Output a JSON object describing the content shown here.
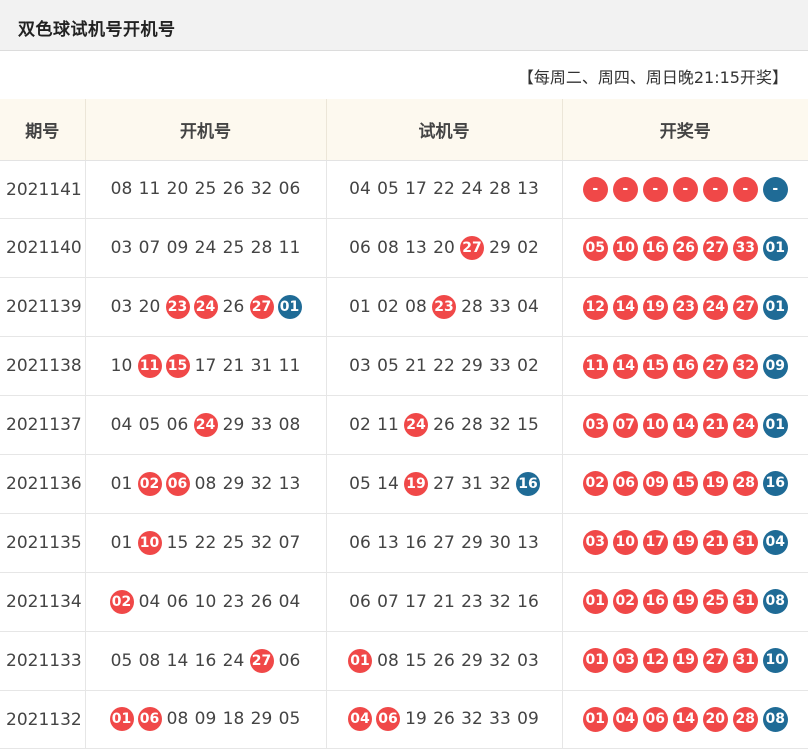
{
  "header": {
    "title": "双色球试机号开机号"
  },
  "notice": "【每周二、周四、周日晚21:15开奖】",
  "colors": {
    "red": "#f04848",
    "blue": "#1f6b96",
    "header_bg": "#fdf9ef"
  },
  "table": {
    "columns": [
      "期号",
      "开机号",
      "试机号",
      "开奖号"
    ],
    "rows": [
      {
        "issue": "2021141",
        "open": [
          [
            "08",
            ""
          ],
          [
            "11",
            ""
          ],
          [
            "20",
            ""
          ],
          [
            "25",
            ""
          ],
          [
            "26",
            ""
          ],
          [
            "32",
            ""
          ],
          [
            "06",
            ""
          ]
        ],
        "test": [
          [
            "04",
            ""
          ],
          [
            "05",
            ""
          ],
          [
            "17",
            ""
          ],
          [
            "22",
            ""
          ],
          [
            "24",
            ""
          ],
          [
            "28",
            ""
          ],
          [
            "13",
            ""
          ]
        ],
        "draw": [
          [
            "-",
            "red"
          ],
          [
            "-",
            "red"
          ],
          [
            "-",
            "red"
          ],
          [
            "-",
            "red"
          ],
          [
            "-",
            "red"
          ],
          [
            "-",
            "red"
          ],
          [
            "-",
            "blue"
          ]
        ]
      },
      {
        "issue": "2021140",
        "open": [
          [
            "03",
            ""
          ],
          [
            "07",
            ""
          ],
          [
            "09",
            ""
          ],
          [
            "24",
            ""
          ],
          [
            "25",
            ""
          ],
          [
            "28",
            ""
          ],
          [
            "11",
            ""
          ]
        ],
        "test": [
          [
            "06",
            ""
          ],
          [
            "08",
            ""
          ],
          [
            "13",
            ""
          ],
          [
            "20",
            ""
          ],
          [
            "27",
            "red"
          ],
          [
            "29",
            ""
          ],
          [
            "02",
            ""
          ]
        ],
        "draw": [
          [
            "05",
            "red"
          ],
          [
            "10",
            "red"
          ],
          [
            "16",
            "red"
          ],
          [
            "26",
            "red"
          ],
          [
            "27",
            "red"
          ],
          [
            "33",
            "red"
          ],
          [
            "01",
            "blue"
          ]
        ]
      },
      {
        "issue": "2021139",
        "open": [
          [
            "03",
            ""
          ],
          [
            "20",
            ""
          ],
          [
            "23",
            "red"
          ],
          [
            "24",
            "red"
          ],
          [
            "26",
            ""
          ],
          [
            "27",
            "red"
          ],
          [
            "01",
            "blue"
          ]
        ],
        "test": [
          [
            "01",
            ""
          ],
          [
            "02",
            ""
          ],
          [
            "08",
            ""
          ],
          [
            "23",
            "red"
          ],
          [
            "28",
            ""
          ],
          [
            "33",
            ""
          ],
          [
            "04",
            ""
          ]
        ],
        "draw": [
          [
            "12",
            "red"
          ],
          [
            "14",
            "red"
          ],
          [
            "19",
            "red"
          ],
          [
            "23",
            "red"
          ],
          [
            "24",
            "red"
          ],
          [
            "27",
            "red"
          ],
          [
            "01",
            "blue"
          ]
        ]
      },
      {
        "issue": "2021138",
        "open": [
          [
            "10",
            ""
          ],
          [
            "11",
            "red"
          ],
          [
            "15",
            "red"
          ],
          [
            "17",
            ""
          ],
          [
            "21",
            ""
          ],
          [
            "31",
            ""
          ],
          [
            "11",
            ""
          ]
        ],
        "test": [
          [
            "03",
            ""
          ],
          [
            "05",
            ""
          ],
          [
            "21",
            ""
          ],
          [
            "22",
            ""
          ],
          [
            "29",
            ""
          ],
          [
            "33",
            ""
          ],
          [
            "02",
            ""
          ]
        ],
        "draw": [
          [
            "11",
            "red"
          ],
          [
            "14",
            "red"
          ],
          [
            "15",
            "red"
          ],
          [
            "16",
            "red"
          ],
          [
            "27",
            "red"
          ],
          [
            "32",
            "red"
          ],
          [
            "09",
            "blue"
          ]
        ]
      },
      {
        "issue": "2021137",
        "open": [
          [
            "04",
            ""
          ],
          [
            "05",
            ""
          ],
          [
            "06",
            ""
          ],
          [
            "24",
            "red"
          ],
          [
            "29",
            ""
          ],
          [
            "33",
            ""
          ],
          [
            "08",
            ""
          ]
        ],
        "test": [
          [
            "02",
            ""
          ],
          [
            "11",
            ""
          ],
          [
            "24",
            "red"
          ],
          [
            "26",
            ""
          ],
          [
            "28",
            ""
          ],
          [
            "32",
            ""
          ],
          [
            "15",
            ""
          ]
        ],
        "draw": [
          [
            "03",
            "red"
          ],
          [
            "07",
            "red"
          ],
          [
            "10",
            "red"
          ],
          [
            "14",
            "red"
          ],
          [
            "21",
            "red"
          ],
          [
            "24",
            "red"
          ],
          [
            "01",
            "blue"
          ]
        ]
      },
      {
        "issue": "2021136",
        "open": [
          [
            "01",
            ""
          ],
          [
            "02",
            "red"
          ],
          [
            "06",
            "red"
          ],
          [
            "08",
            ""
          ],
          [
            "29",
            ""
          ],
          [
            "32",
            ""
          ],
          [
            "13",
            ""
          ]
        ],
        "test": [
          [
            "05",
            ""
          ],
          [
            "14",
            ""
          ],
          [
            "19",
            "red"
          ],
          [
            "27",
            ""
          ],
          [
            "31",
            ""
          ],
          [
            "32",
            ""
          ],
          [
            "16",
            "blue"
          ]
        ],
        "draw": [
          [
            "02",
            "red"
          ],
          [
            "06",
            "red"
          ],
          [
            "09",
            "red"
          ],
          [
            "15",
            "red"
          ],
          [
            "19",
            "red"
          ],
          [
            "28",
            "red"
          ],
          [
            "16",
            "blue"
          ]
        ]
      },
      {
        "issue": "2021135",
        "open": [
          [
            "01",
            ""
          ],
          [
            "10",
            "red"
          ],
          [
            "15",
            ""
          ],
          [
            "22",
            ""
          ],
          [
            "25",
            ""
          ],
          [
            "32",
            ""
          ],
          [
            "07",
            ""
          ]
        ],
        "test": [
          [
            "06",
            ""
          ],
          [
            "13",
            ""
          ],
          [
            "16",
            ""
          ],
          [
            "27",
            ""
          ],
          [
            "29",
            ""
          ],
          [
            "30",
            ""
          ],
          [
            "13",
            ""
          ]
        ],
        "draw": [
          [
            "03",
            "red"
          ],
          [
            "10",
            "red"
          ],
          [
            "17",
            "red"
          ],
          [
            "19",
            "red"
          ],
          [
            "21",
            "red"
          ],
          [
            "31",
            "red"
          ],
          [
            "04",
            "blue"
          ]
        ]
      },
      {
        "issue": "2021134",
        "open": [
          [
            "02",
            "red"
          ],
          [
            "04",
            ""
          ],
          [
            "06",
            ""
          ],
          [
            "10",
            ""
          ],
          [
            "23",
            ""
          ],
          [
            "26",
            ""
          ],
          [
            "04",
            ""
          ]
        ],
        "test": [
          [
            "06",
            ""
          ],
          [
            "07",
            ""
          ],
          [
            "17",
            ""
          ],
          [
            "21",
            ""
          ],
          [
            "23",
            ""
          ],
          [
            "32",
            ""
          ],
          [
            "16",
            ""
          ]
        ],
        "draw": [
          [
            "01",
            "red"
          ],
          [
            "02",
            "red"
          ],
          [
            "16",
            "red"
          ],
          [
            "19",
            "red"
          ],
          [
            "25",
            "red"
          ],
          [
            "31",
            "red"
          ],
          [
            "08",
            "blue"
          ]
        ]
      },
      {
        "issue": "2021133",
        "open": [
          [
            "05",
            ""
          ],
          [
            "08",
            ""
          ],
          [
            "14",
            ""
          ],
          [
            "16",
            ""
          ],
          [
            "24",
            ""
          ],
          [
            "27",
            "red"
          ],
          [
            "06",
            ""
          ]
        ],
        "test": [
          [
            "01",
            "red"
          ],
          [
            "08",
            ""
          ],
          [
            "15",
            ""
          ],
          [
            "26",
            ""
          ],
          [
            "29",
            ""
          ],
          [
            "32",
            ""
          ],
          [
            "03",
            ""
          ]
        ],
        "draw": [
          [
            "01",
            "red"
          ],
          [
            "03",
            "red"
          ],
          [
            "12",
            "red"
          ],
          [
            "19",
            "red"
          ],
          [
            "27",
            "red"
          ],
          [
            "31",
            "red"
          ],
          [
            "10",
            "blue"
          ]
        ]
      },
      {
        "issue": "2021132",
        "open": [
          [
            "01",
            "red"
          ],
          [
            "06",
            "red"
          ],
          [
            "08",
            ""
          ],
          [
            "09",
            ""
          ],
          [
            "18",
            ""
          ],
          [
            "29",
            ""
          ],
          [
            "05",
            ""
          ]
        ],
        "test": [
          [
            "04",
            "red"
          ],
          [
            "06",
            "red"
          ],
          [
            "19",
            ""
          ],
          [
            "26",
            ""
          ],
          [
            "32",
            ""
          ],
          [
            "33",
            ""
          ],
          [
            "09",
            ""
          ]
        ],
        "draw": [
          [
            "01",
            "red"
          ],
          [
            "04",
            "red"
          ],
          [
            "06",
            "red"
          ],
          [
            "14",
            "red"
          ],
          [
            "20",
            "red"
          ],
          [
            "28",
            "red"
          ],
          [
            "08",
            "blue"
          ]
        ]
      }
    ]
  }
}
